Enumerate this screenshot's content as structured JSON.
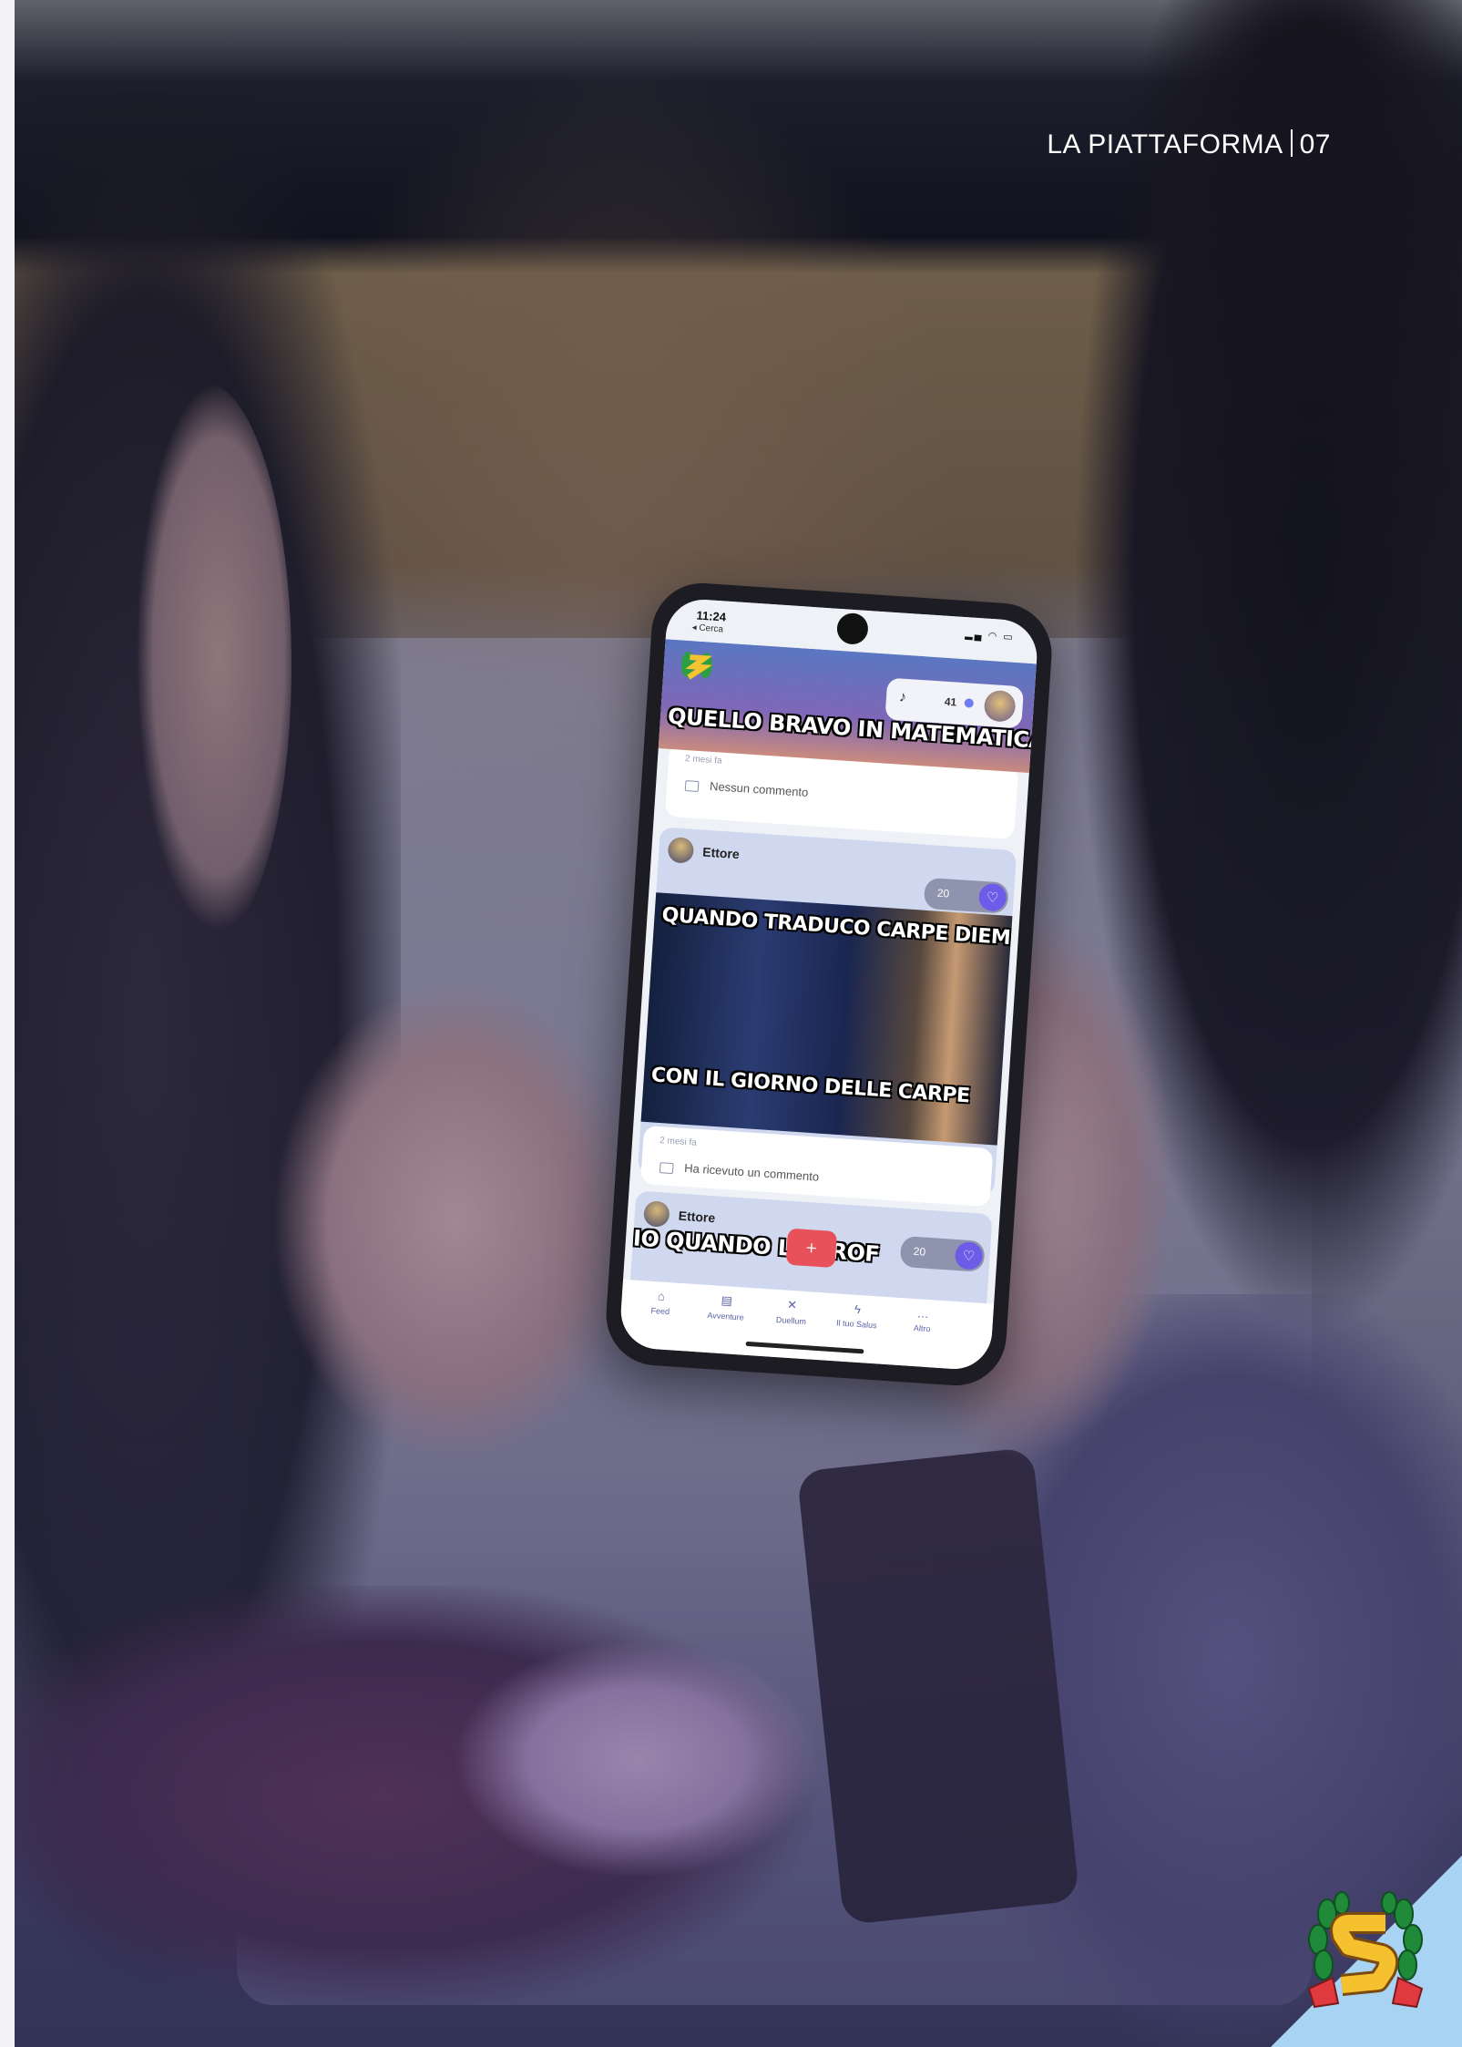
{
  "header": {
    "section": "LA PIATTAFORMA",
    "page": "07"
  },
  "phone": {
    "status": {
      "time": "11:24",
      "back": "◂ Cerca"
    },
    "topbar": {
      "coins": "41"
    },
    "feed": [
      {
        "caption": "QUELLO BRAVO IN MATEMATICA:",
        "ago": "2 mesi fa",
        "comment": "Nessun commento"
      },
      {
        "author": "Ettore",
        "likes": "20",
        "caption_top": "QUANDO TRADUCO CARPE DIEM",
        "caption_bottom": "CON IL GIORNO DELLE CARPE",
        "ago": "2 mesi fa",
        "comment": "Ha ricevuto un commento"
      },
      {
        "author": "Ettore",
        "likes": "20",
        "caption_top": "IO QUANDO LA PROF"
      }
    ],
    "fab": "+",
    "tabs": [
      "Feed",
      "Avventure",
      "Duellum",
      "Il tuo Salus",
      "Altro"
    ]
  },
  "colors": {
    "accent": "#6c5ce7",
    "fab": "#e8515a",
    "corner": "#a9d3f2"
  },
  "icons": [
    "bell-icon",
    "heart-icon",
    "comment-icon",
    "home-icon",
    "adventure-icon",
    "duel-icon",
    "lightning-icon",
    "more-icon",
    "laurel-logo"
  ]
}
